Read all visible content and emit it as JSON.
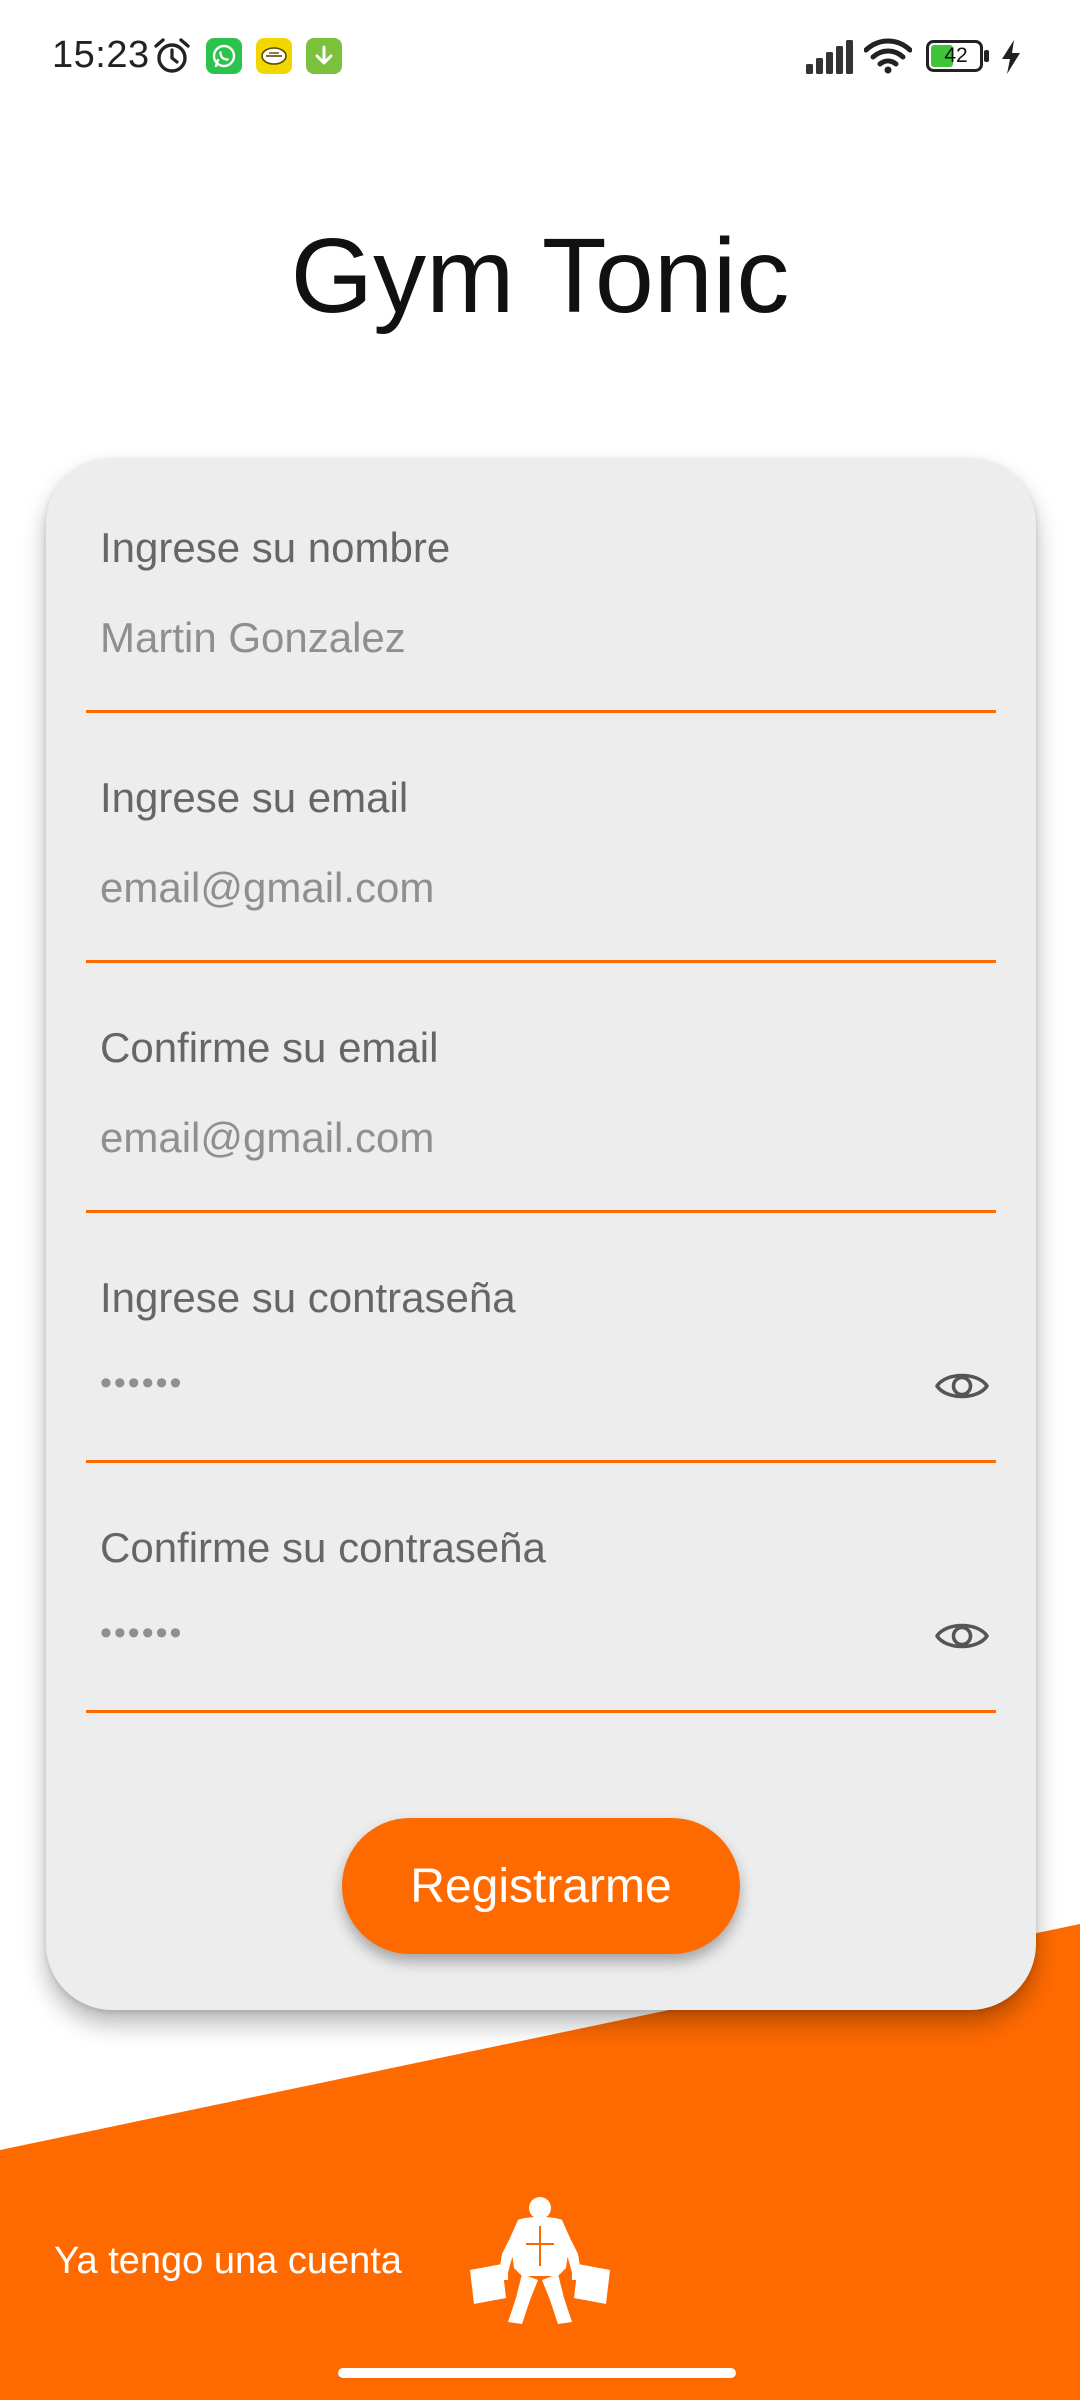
{
  "status_bar": {
    "time": "15:23",
    "battery_level": "42",
    "icons": [
      "alarm-icon",
      "whatsapp-icon",
      "emoji-app-icon",
      "download-icon",
      "signal-icon",
      "wifi-icon",
      "battery-icon",
      "charging-bolt-icon"
    ]
  },
  "app": {
    "title": "Gym Tonic"
  },
  "form": {
    "name_label": "Ingrese su nombre",
    "name_placeholder": "Martin Gonzalez",
    "email_label": "Ingrese su email",
    "email_placeholder": "email@gmail.com",
    "confirm_email_label": "Confirme su email",
    "confirm_email_placeholder": "email@gmail.com",
    "password_label": "Ingrese su contraseña",
    "password_placeholder": "••••••",
    "confirm_password_label": "Confirme su contraseña",
    "confirm_password_placeholder": "••••••",
    "submit_label": "Registrarme"
  },
  "footer": {
    "login_link": "Ya tengo una cuenta",
    "logo_icon": "weightlifter-icon"
  },
  "colors": {
    "accent": "#FF6A00",
    "card_bg": "#EDEDED",
    "background": "#FFFFFF"
  }
}
